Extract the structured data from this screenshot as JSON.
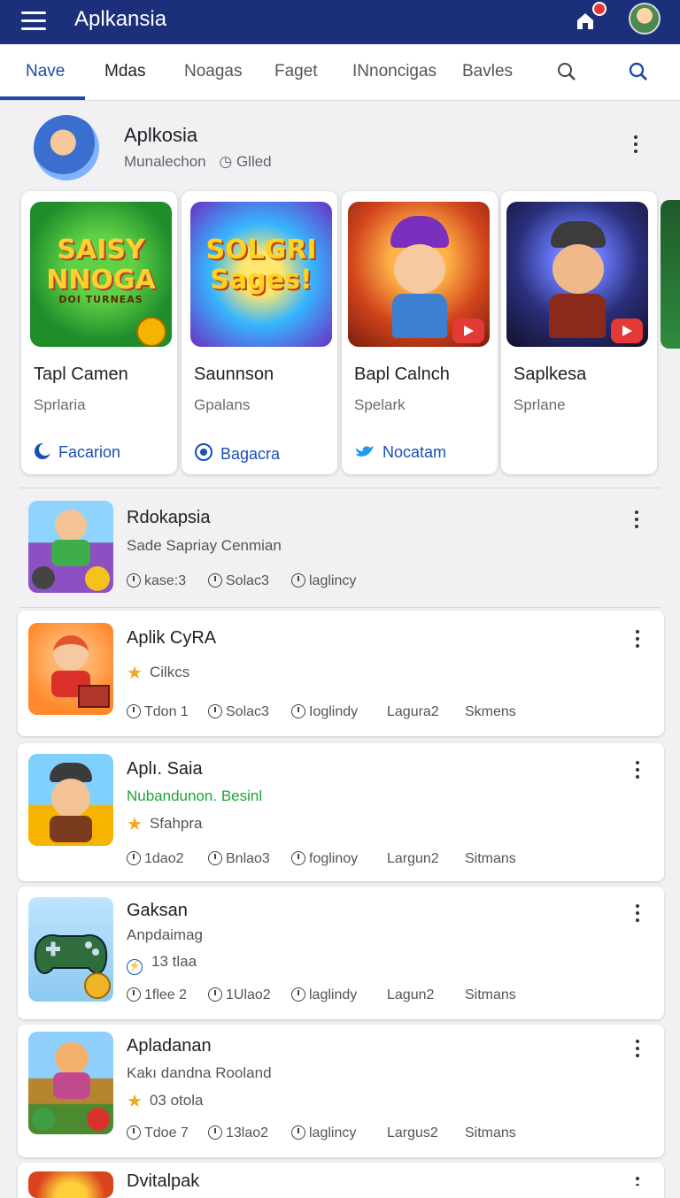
{
  "app": {
    "title": "Aplkansia"
  },
  "tabs": [
    {
      "label": "Nave"
    },
    {
      "label": "Mdas"
    },
    {
      "label": "Noagas"
    },
    {
      "label": "Faget"
    },
    {
      "label": "INnoncigas"
    },
    {
      "label": "Bavles"
    }
  ],
  "featured": {
    "title": "Aplkosia",
    "subtitle": "Munalechon",
    "subtitle_tag": "Glled",
    "cards": [
      {
        "name": "Tapl Camen",
        "sub": "Sprlaria",
        "link": "Facarion",
        "art": "SAISY NNOGA",
        "art_small": "DOI TURNEAS"
      },
      {
        "name": "Saunnson",
        "sub": "Gpalans",
        "link": "Bagacra",
        "art": "SOLGRI Sages!"
      },
      {
        "name": "Bapl Calnch",
        "sub": "Spelark",
        "link": "Nocatam"
      },
      {
        "name": "Saplkesa",
        "sub": "Sprlane",
        "link": ""
      }
    ]
  },
  "list": [
    {
      "title": "Rdokapsia",
      "line1": "Sade Sapriay Cenmian",
      "meta": [
        "kase:3",
        "Solac3",
        "laglincy"
      ]
    },
    {
      "title": "Aplik CyRA",
      "rating": "Cilkcs",
      "meta": [
        "Tdon 1",
        "Solac3",
        "Ioglindy",
        "Lagura2",
        "Skmens"
      ]
    },
    {
      "title": "Aplı. Saia",
      "line1": "Nubandunon. Besinl",
      "rating": "Sfahpra",
      "meta": [
        "1dao2",
        "Bnlao3",
        "foglinoy",
        "Largun2",
        "Sitmans"
      ]
    },
    {
      "title": "Gaksan",
      "line1": "Anpdaimag",
      "rating": "13 tlaa",
      "meta": [
        "1flee 2",
        "1Ulao2",
        "laglindy",
        "Lagun2",
        "Sitmans"
      ]
    },
    {
      "title": "Apladanan",
      "line1": "Kakı dandna Rooland",
      "rating": "03 otola",
      "meta": [
        "Tdoe 7",
        "13lao2",
        "laglincy",
        "Largus2",
        "Sitmans"
      ]
    },
    {
      "title": "Dvitalpak"
    }
  ]
}
